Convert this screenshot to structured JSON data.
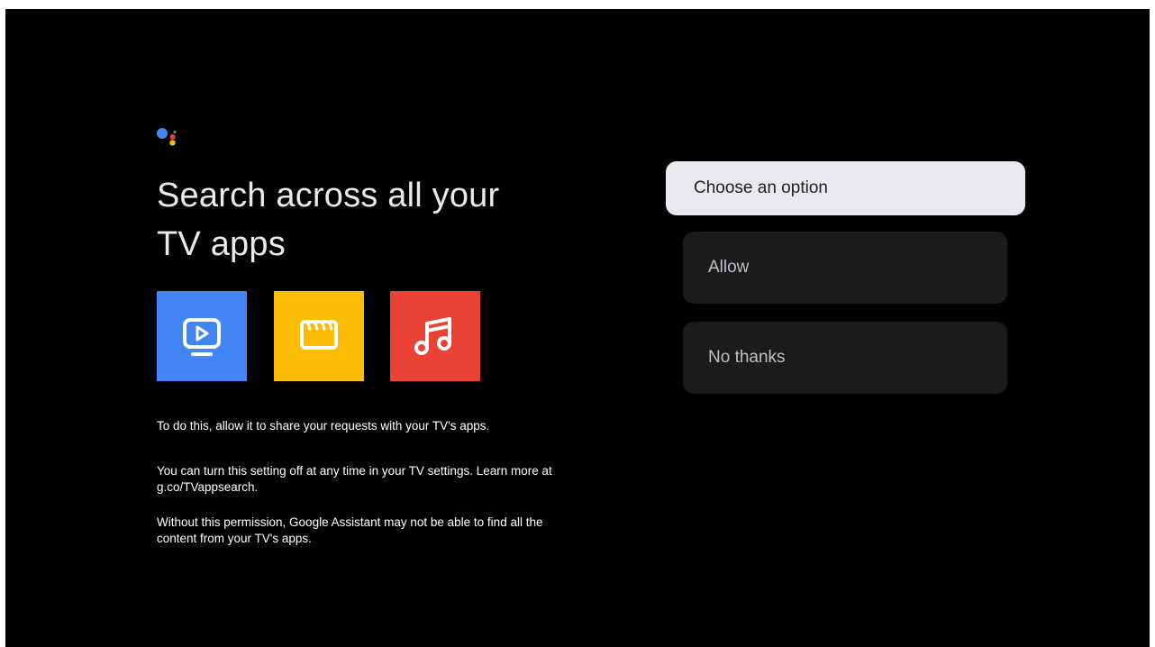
{
  "header": {
    "logo_icon": "google-assistant-icon",
    "title_line1": "Search across all your",
    "title_line2": "TV apps"
  },
  "app_tiles": [
    {
      "icon": "tv-play-icon",
      "color": "#4285f4"
    },
    {
      "icon": "clapperboard-icon",
      "color": "#fbbc04"
    },
    {
      "icon": "music-note-icon",
      "color": "#ea4335"
    }
  ],
  "info": {
    "share": "To do this, allow it to share your requests with your TV's apps.",
    "setting": "You can turn this setting off at any time in your TV settings. Learn more at g.co/TVappsearch.",
    "permission": "Without this permission, Google Assistant may not be able to find all the content from your TV's apps."
  },
  "options": {
    "choose_label": "Choose an option",
    "allow_label": "Allow",
    "no_thanks_label": "No thanks"
  },
  "colors": {
    "background": "#000000",
    "focused_option": "#e8eaed",
    "option": "#1b1b1b",
    "assistant_blue": "#4285f4",
    "assistant_red": "#ea4335",
    "assistant_yellow": "#fbbc04",
    "assistant_green": "#34a853"
  }
}
